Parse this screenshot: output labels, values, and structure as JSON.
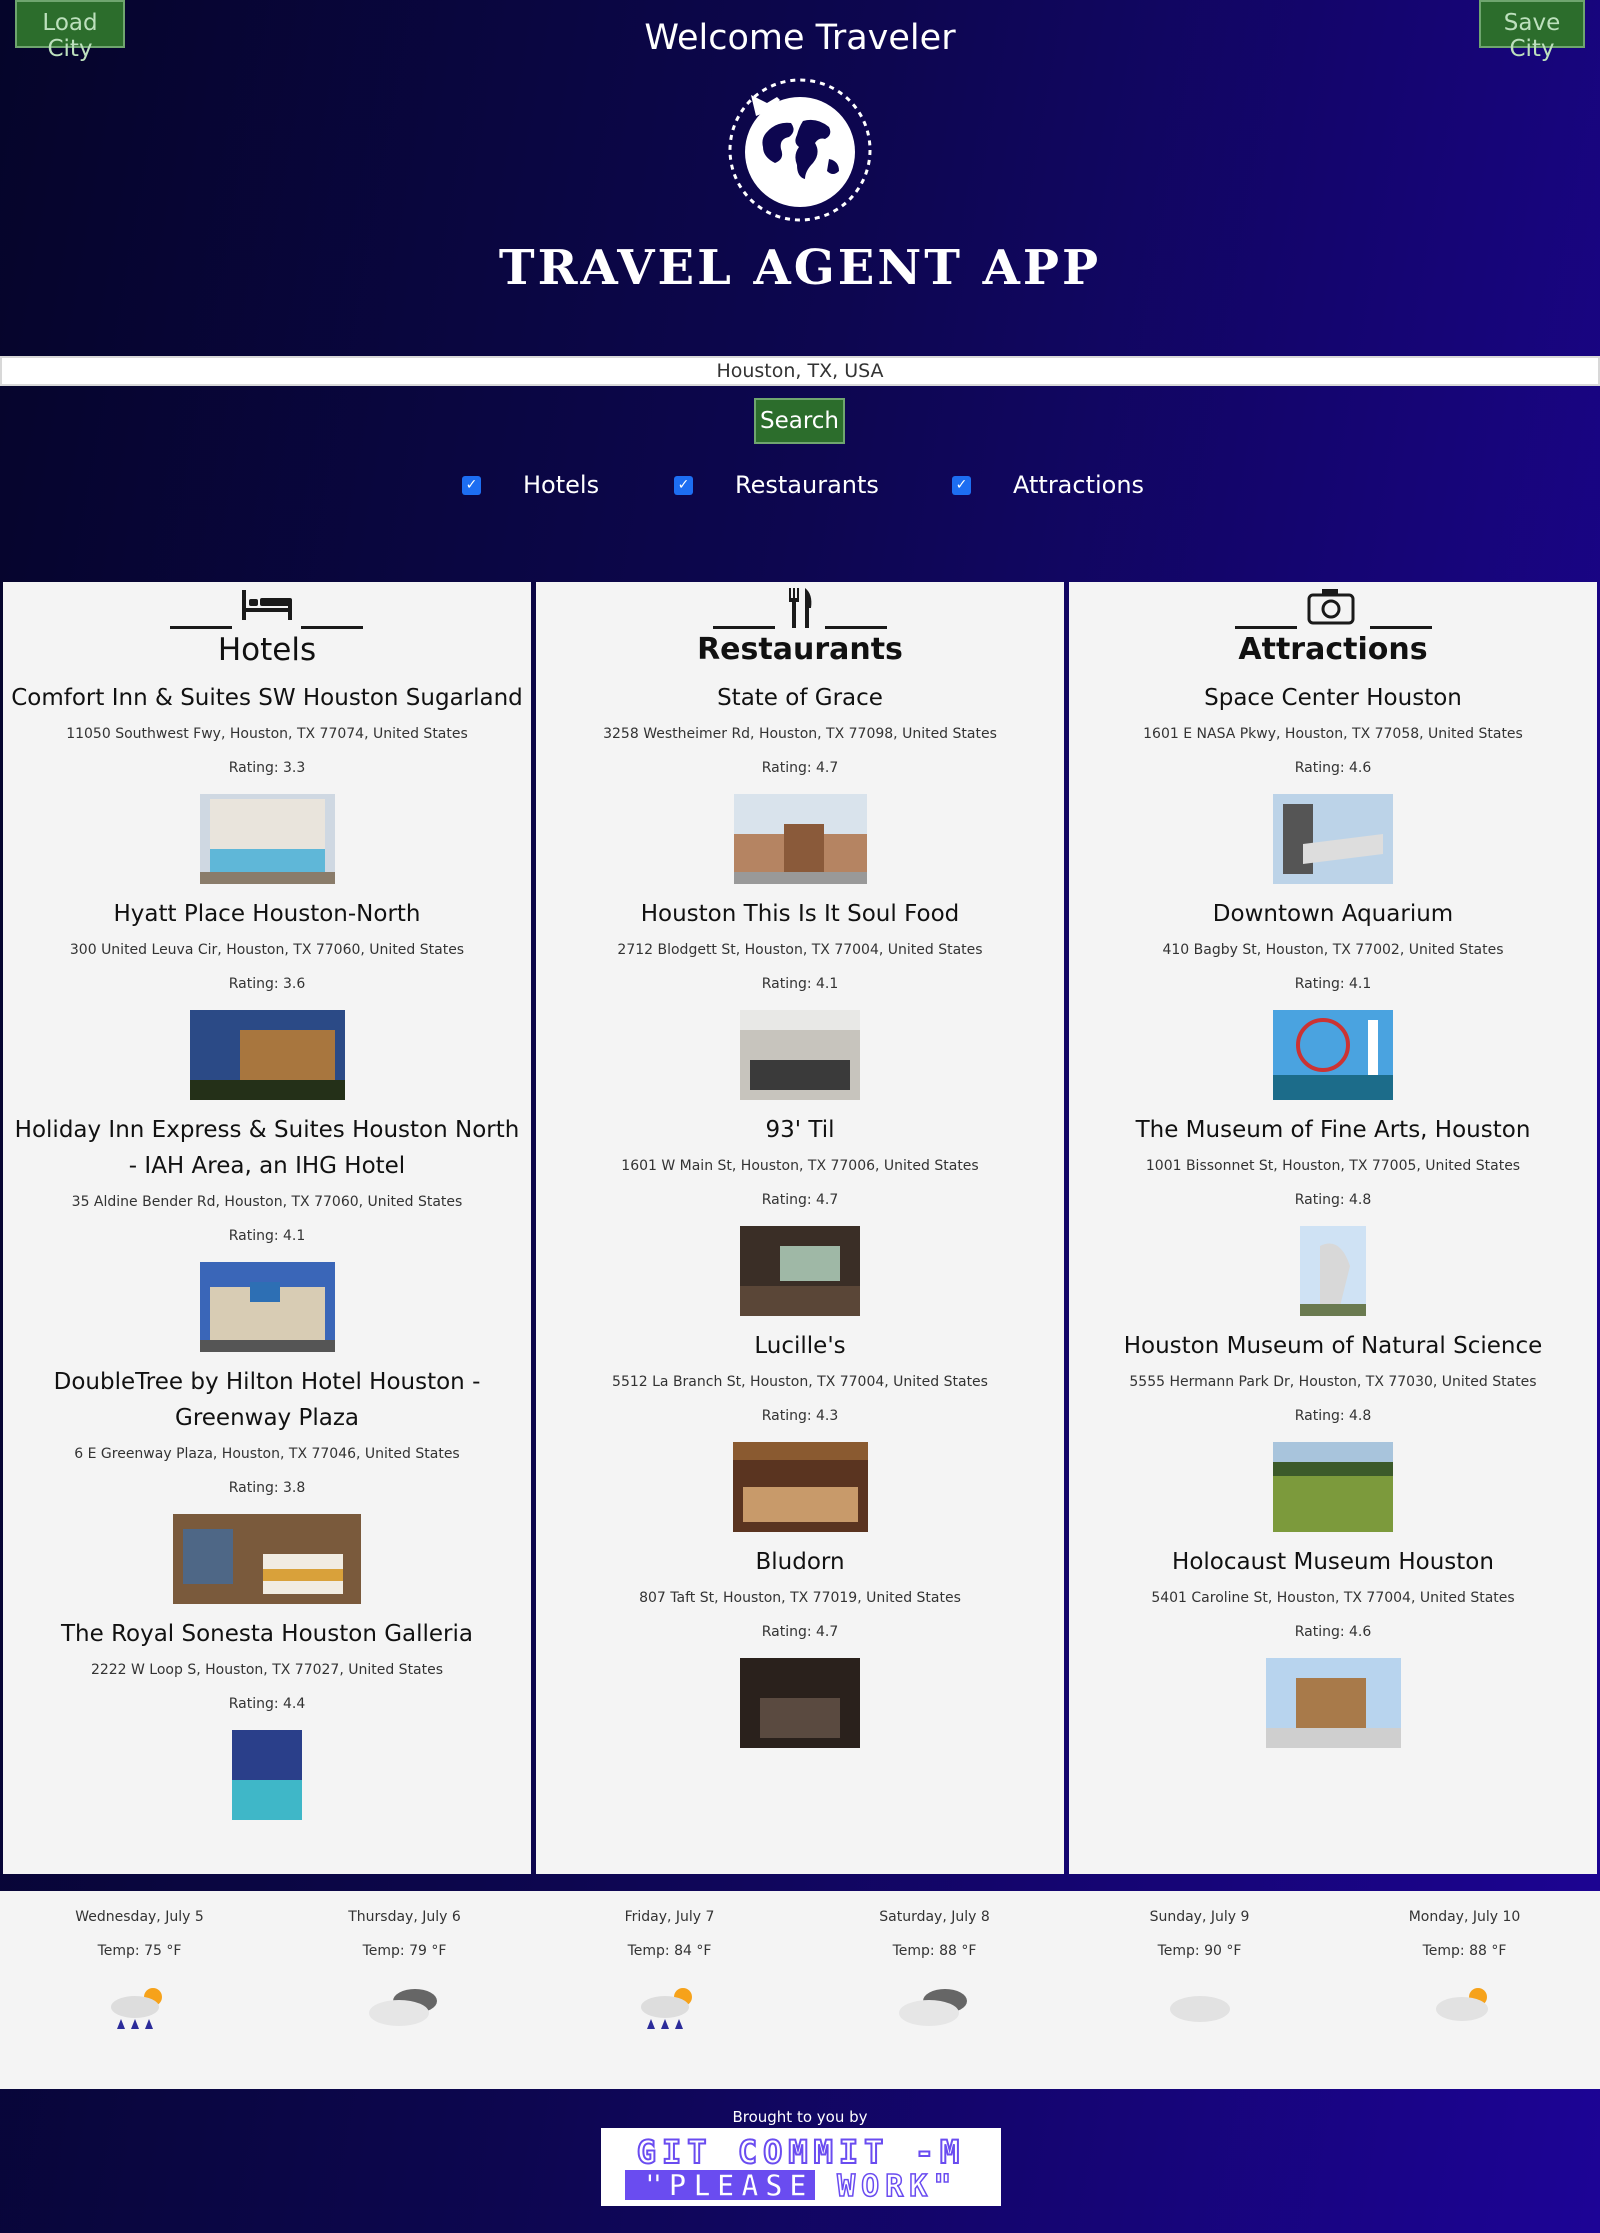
{
  "header": {
    "load_label": "Load City",
    "save_label": "Save City",
    "welcome": "Welcome Traveler",
    "app_title": "TRAVEL AGENT APP"
  },
  "search": {
    "value": "Houston, TX, USA",
    "button": "Search"
  },
  "filters": [
    {
      "label": "Hotels",
      "checked": true
    },
    {
      "label": "Restaurants",
      "checked": true
    },
    {
      "label": "Attractions",
      "checked": true
    }
  ],
  "columns": {
    "hotels": {
      "title": "Hotels",
      "icon": "bed-icon",
      "items": [
        {
          "name": "Comfort Inn & Suites SW Houston Sugarland",
          "address": "11050 Southwest Fwy, Houston, TX 77074, United States",
          "rating": "Rating: 3.3"
        },
        {
          "name": "Hyatt Place Houston-North",
          "address": "300 United Leuva Cir, Houston, TX 77060, United States",
          "rating": "Rating: 3.6"
        },
        {
          "name": "Holiday Inn Express & Suites Houston North - IAH Area, an IHG Hotel",
          "address": "35 Aldine Bender Rd, Houston, TX 77060, United States",
          "rating": "Rating: 4.1"
        },
        {
          "name": "DoubleTree by Hilton Hotel Houston - Greenway Plaza",
          "address": "6 E Greenway Plaza, Houston, TX 77046, United States",
          "rating": "Rating: 3.8"
        },
        {
          "name": "The Royal Sonesta Houston Galleria",
          "address": "2222 W Loop S, Houston, TX 77027, United States",
          "rating": "Rating: 4.4"
        }
      ]
    },
    "restaurants": {
      "title": "Restaurants",
      "icon": "fork-knife-icon",
      "items": [
        {
          "name": "State of Grace",
          "address": "3258 Westheimer Rd, Houston, TX 77098, United States",
          "rating": "Rating: 4.7"
        },
        {
          "name": "Houston This Is It Soul Food",
          "address": "2712 Blodgett St, Houston, TX 77004, United States",
          "rating": "Rating: 4.1"
        },
        {
          "name": "93' Til",
          "address": "1601 W Main St, Houston, TX 77006, United States",
          "rating": "Rating: 4.7"
        },
        {
          "name": "Lucille's",
          "address": "5512 La Branch St, Houston, TX 77004, United States",
          "rating": "Rating: 4.3"
        },
        {
          "name": "Bludorn",
          "address": "807 Taft St, Houston, TX 77019, United States",
          "rating": "Rating: 4.7"
        }
      ]
    },
    "attractions": {
      "title": "Attractions",
      "icon": "camera-icon",
      "items": [
        {
          "name": "Space Center Houston",
          "address": "1601 E NASA Pkwy, Houston, TX 77058, United States",
          "rating": "Rating: 4.6"
        },
        {
          "name": "Downtown Aquarium",
          "address": "410 Bagby St, Houston, TX 77002, United States",
          "rating": "Rating: 4.1"
        },
        {
          "name": "The Museum of Fine Arts, Houston",
          "address": "1001 Bissonnet St, Houston, TX 77005, United States",
          "rating": "Rating: 4.8"
        },
        {
          "name": "Houston Museum of Natural Science",
          "address": "5555 Hermann Park Dr, Houston, TX 77030, United States",
          "rating": "Rating: 4.8"
        },
        {
          "name": "Holocaust Museum Houston",
          "address": "5401 Caroline St, Houston, TX 77004, United States",
          "rating": "Rating: 4.6"
        }
      ]
    }
  },
  "weather": [
    {
      "date": "Wednesday, July 5",
      "temp": "Temp: 75 °F",
      "icon": "rain-sun-icon"
    },
    {
      "date": "Thursday, July 6",
      "temp": "Temp: 79 °F",
      "icon": "cloudy-icon"
    },
    {
      "date": "Friday, July 7",
      "temp": "Temp: 84 °F",
      "icon": "rain-sun-icon"
    },
    {
      "date": "Saturday, July 8",
      "temp": "Temp: 88 °F",
      "icon": "cloudy-icon"
    },
    {
      "date": "Sunday, July 9",
      "temp": "Temp: 90 °F",
      "icon": "cloud-icon"
    },
    {
      "date": "Monday, July 10",
      "temp": "Temp: 88 °F",
      "icon": "partly-sunny-icon"
    }
  ],
  "footer": {
    "brought_by": "Brought to you by",
    "logo_line1": "GIT COMMIT -M",
    "logo_line2": "\"PLEASE WORK\""
  },
  "colors": {
    "button_green": "#2c6d2c",
    "checkbox_blue": "#1d6ef2",
    "logo_purple": "#6a4cf0"
  }
}
